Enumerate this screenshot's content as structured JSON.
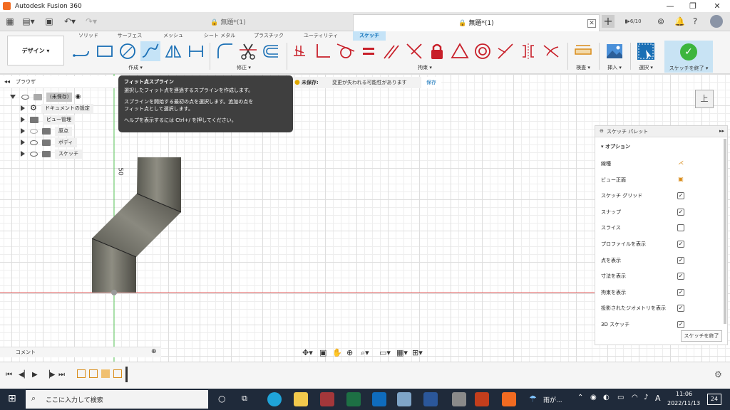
{
  "window": {
    "title": "Autodesk Fusion 360"
  },
  "tabs": [
    {
      "label": "無題*(1)"
    },
    {
      "label": "無題*(1)"
    }
  ],
  "header": {
    "job_count": "6/10"
  },
  "ribbon": {
    "design_menu": "デザイン ▾",
    "tabs": [
      "ソリッド",
      "サーフェス",
      "メッシュ",
      "シート メタル",
      "プラスチック",
      "ユーティリティ",
      "スケッチ"
    ],
    "groups": {
      "create": "作成 ▾",
      "modify": "修正 ▾",
      "constraints": "拘束 ▾",
      "inspect": "検査 ▾",
      "insert": "挿入 ▾",
      "select": "選択 ▾",
      "finish": "スケッチを終了 ▾"
    }
  },
  "browser": {
    "title": "ブラウザ",
    "root": "(未保存)",
    "items": [
      "ドキュメントの設定",
      "ビュー管理",
      "原点",
      "ボディ",
      "スケッチ"
    ]
  },
  "tooltip": {
    "title": "フィット点スプライン",
    "line1": "選択したフィット点を連過するスプラインを作成します。",
    "line2a": "スプラインを開始する最初の点を選択します。追加の点を",
    "line2b": "フィット点として選択します。",
    "line3": "ヘルプを表示するには Ctrl+/ を押してください。"
  },
  "unsaved": {
    "label": "未保存:",
    "message": "変更が失われる可能性があります",
    "save": "保存"
  },
  "viewcube": {
    "label": "上"
  },
  "canvas": {
    "dimension": "50"
  },
  "palette": {
    "title": "スケッチ パレット",
    "section": "オプション",
    "rows": [
      {
        "label": "線種",
        "checked": null
      },
      {
        "label": "ビュー正面",
        "checked": null
      },
      {
        "label": "スケッチ グリッド",
        "checked": true
      },
      {
        "label": "スナップ",
        "checked": true
      },
      {
        "label": "スライス",
        "checked": false
      },
      {
        "label": "プロファイルを表示",
        "checked": true
      },
      {
        "label": "点を表示",
        "checked": true
      },
      {
        "label": "寸法を表示",
        "checked": true
      },
      {
        "label": "拘束を表示",
        "checked": true
      },
      {
        "label": "投影されたジオメトリを表示",
        "checked": true
      },
      {
        "label": "3D スケッチ",
        "checked": true
      }
    ],
    "finish_button": "スケッチを終了"
  },
  "comment": {
    "label": "コメント"
  },
  "taskbar": {
    "search_placeholder": "ここに入力して検索",
    "weather": "雨が...",
    "ime": "A",
    "time": "11:06",
    "date": "2022/11/13",
    "notifications": "24"
  },
  "colors": {
    "accent": "#0d6fb8",
    "constraint_red": "#c8202a",
    "finish_green": "#3db53d"
  }
}
